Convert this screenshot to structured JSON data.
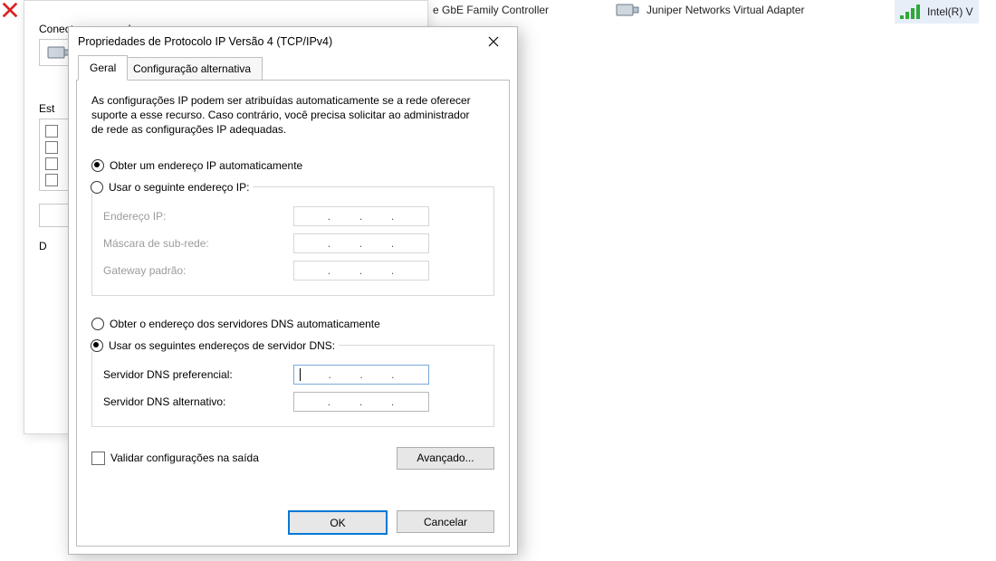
{
  "background": {
    "adapter1": "e GbE Family Controller",
    "adapter2": "Juniper Networks Virtual Adapter",
    "adapter3": "Intel(R) V",
    "panel1": {
      "connect_label": "Conectar-se usando:",
      "status_label": "Est",
      "desc_label": "D"
    }
  },
  "dialog": {
    "title": "Propriedades de Protocolo IP Versão 4 (TCP/IPv4)",
    "tabs": {
      "general": "Geral",
      "alt": "Configuração alternativa"
    },
    "intro": "As configurações IP podem ser atribuídas automaticamente se a rede oferecer suporte a esse recurso. Caso contrário, você precisa solicitar ao administrador de rede as configurações IP adequadas.",
    "ip": {
      "auto": "Obter um endereço IP automaticamente",
      "manual": "Usar o seguinte endereço IP:",
      "selected": "auto",
      "fields": {
        "address": "Endereço IP:",
        "mask": "Máscara de sub-rede:",
        "gateway": "Gateway padrão:"
      },
      "values": {
        "address": "",
        "mask": "",
        "gateway": ""
      }
    },
    "dns": {
      "auto": "Obter o endereço dos servidores DNS automaticamente",
      "manual": "Usar os seguintes endereços de servidor DNS:",
      "selected": "manual",
      "fields": {
        "pref": "Servidor DNS preferencial:",
        "alt": "Servidor DNS alternativo:"
      },
      "values": {
        "pref": "",
        "alt": ""
      }
    },
    "validate": "Validar configurações na saída",
    "validate_checked": false,
    "advanced": "Avançado...",
    "buttons": {
      "ok": "OK",
      "cancel": "Cancelar"
    }
  }
}
